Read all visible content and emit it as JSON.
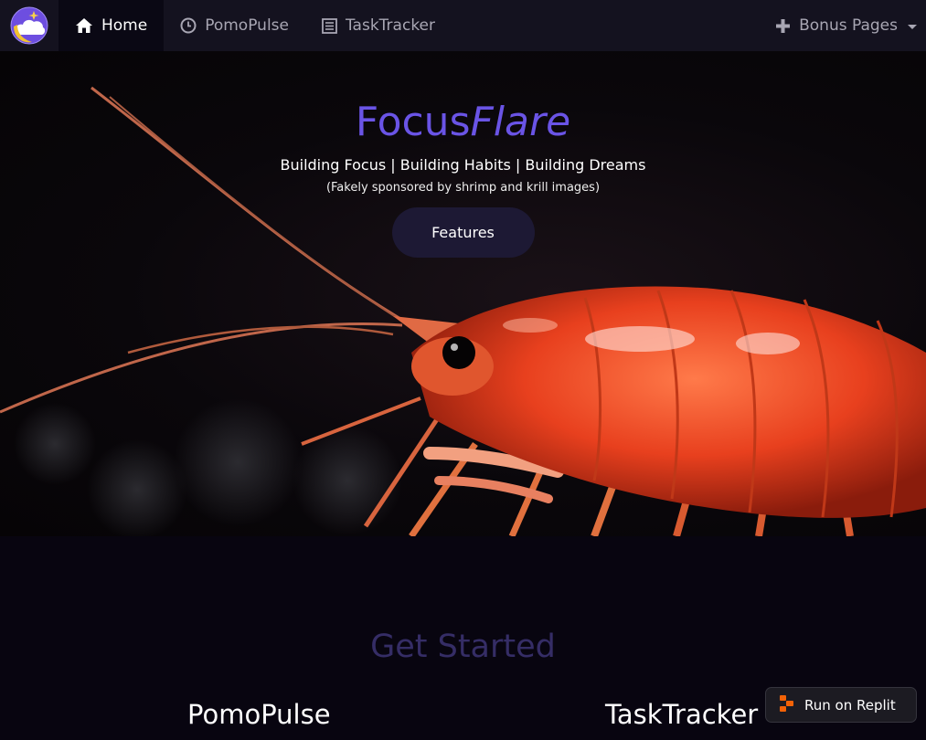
{
  "nav": {
    "home": "Home",
    "pomopulse": "PomoPulse",
    "tasktracker": "TaskTracker",
    "bonus": "Bonus Pages"
  },
  "hero": {
    "brand_main": "Focus",
    "brand_italic": "Flare",
    "tagline": "Building Focus | Building Habits | Building Dreams",
    "sponsor": "(Fakely sponsored by shrimp and krill images)",
    "features_button": "Features"
  },
  "section": {
    "title": "Get Started",
    "cards": [
      "PomoPulse",
      "TaskTracker"
    ]
  },
  "replit": {
    "label": "Run on Replit"
  },
  "colors": {
    "accent": "#6a54e6",
    "nav_bg": "#14121f",
    "button_bg": "#1d1934",
    "section_title": "#352d66"
  },
  "icons": [
    "logo-icon",
    "home-icon",
    "clock-icon",
    "list-icon",
    "plus-icon",
    "replit-icon"
  ]
}
